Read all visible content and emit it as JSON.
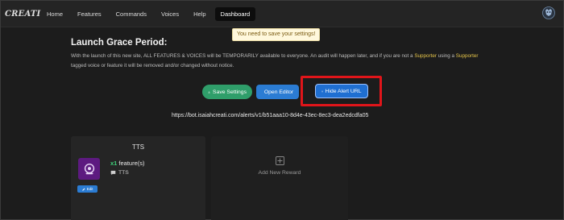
{
  "nav": {
    "logo_text": "CREATI",
    "items": [
      {
        "label": "Home",
        "active": false
      },
      {
        "label": "Features",
        "active": false
      },
      {
        "label": "Commands",
        "active": false
      },
      {
        "label": "Voices",
        "active": false
      },
      {
        "label": "Help",
        "active": false
      },
      {
        "label": "Dashboard",
        "active": true
      }
    ]
  },
  "toast": {
    "text": "You need to save your settings!"
  },
  "main": {
    "heading": "Launch Grace Period:",
    "notice_part1": "With the launch of this new site, ALL FEATURES & VOICES will be TEMPORARILY available to everyone. An audit will happen later, and if you are not a ",
    "notice_hl1": "Supporter",
    "notice_part2": " using a ",
    "notice_hl2": "Supporter",
    "notice_part3": " tagged voice or feature it will be removed and/or changed without notice.",
    "buttons": {
      "save": "Save Settings",
      "editor": "Open Editor",
      "hide_url": "Hide Alert URL"
    },
    "alert_url": "https://bot.isaiahcreati.com/alerts/v1/b51aaa10-8d4e-43ec-8ec3-dea2edcdfa05"
  },
  "cards": {
    "tts": {
      "title": "TTS",
      "multiplier": "x1",
      "feature_text": " feature(s)",
      "type": "TTS",
      "edit_label": "Edit"
    },
    "add": {
      "label": "Add New Reward"
    }
  },
  "colors": {
    "save_button": "#2f9e6a",
    "primary_button": "#2b7cd3",
    "highlight_box": "#e0151a",
    "supporter_text": "#e7c64a",
    "multiplier": "#3fcf7a",
    "tts_icon_bg": "#5d1a80"
  },
  "icons": {
    "save": "download-icon",
    "editor": "external-link-icon",
    "hide_url": "eye-off-icon",
    "type": "chat-bubble-icon",
    "add": "plus-square-icon",
    "profile": "user-avatar-icon"
  }
}
